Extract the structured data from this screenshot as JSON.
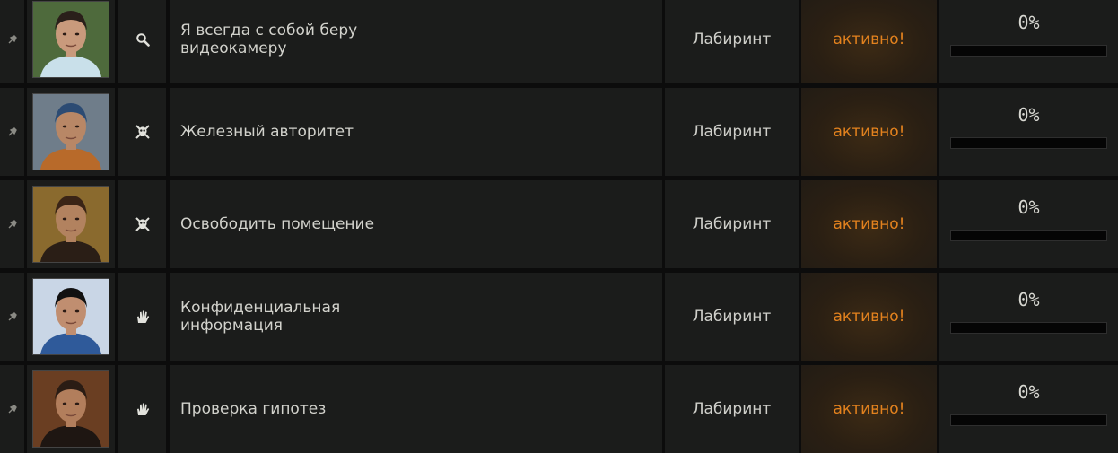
{
  "quests": [
    {
      "name": "Я всегда с собой беру\nвидеокамеру",
      "type_icon": "search-icon",
      "location": "Лабиринт",
      "status": "активно!",
      "progress_text": "0%",
      "progress": 0,
      "avatar_colors": {
        "bg": "#4e6a3c",
        "face": "#c99a7c",
        "hair": "#2a1f1a",
        "body": "#c9e0ea"
      }
    },
    {
      "name": "Железный авторитет",
      "type_icon": "skull-icon",
      "location": "Лабиринт",
      "status": "активно!",
      "progress_text": "0%",
      "progress": 0,
      "avatar_colors": {
        "bg": "#6f7d8a",
        "face": "#b88766",
        "hair": "#2c4b73",
        "body": "#b86a2a"
      }
    },
    {
      "name": "Освободить помещение",
      "type_icon": "skull-icon",
      "location": "Лабиринт",
      "status": "активно!",
      "progress_text": "0%",
      "progress": 0,
      "avatar_colors": {
        "bg": "#8a6a2e",
        "face": "#b2825f",
        "hair": "#3a2416",
        "body": "#2a1e16"
      }
    },
    {
      "name": "Конфиденциальная\nинформация",
      "type_icon": "hand-icon",
      "location": "Лабиринт",
      "status": "активно!",
      "progress_text": "0%",
      "progress": 0,
      "avatar_colors": {
        "bg": "#c9d6e6",
        "face": "#c08e70",
        "hair": "#111111",
        "body": "#2f5a9a"
      }
    },
    {
      "name": "Проверка гипотез",
      "type_icon": "hand-icon",
      "location": "Лабиринт",
      "status": "активно!",
      "progress_text": "0%",
      "progress": 0,
      "avatar_colors": {
        "bg": "#6a3e22",
        "face": "#b27e5c",
        "hair": "#2a1c14",
        "body": "#1e1612"
      }
    }
  ]
}
